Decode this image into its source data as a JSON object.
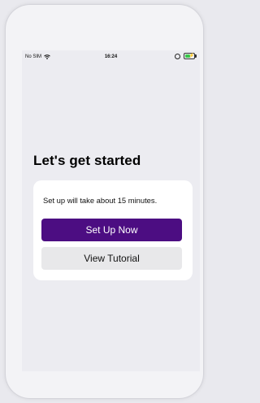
{
  "status_bar": {
    "carrier": "No SIM",
    "time": "16:24"
  },
  "onboarding": {
    "heading": "Let's get started",
    "description": "Set up will take about 15 minutes.",
    "primary_button": "Set Up Now",
    "secondary_button": "View Tutorial"
  },
  "colors": {
    "primary": "#4c0d82",
    "secondary": "#e8e8ea",
    "battery": "#37c54a"
  },
  "icons": [
    "wifi-icon",
    "alarm-icon",
    "battery-charging-icon"
  ]
}
